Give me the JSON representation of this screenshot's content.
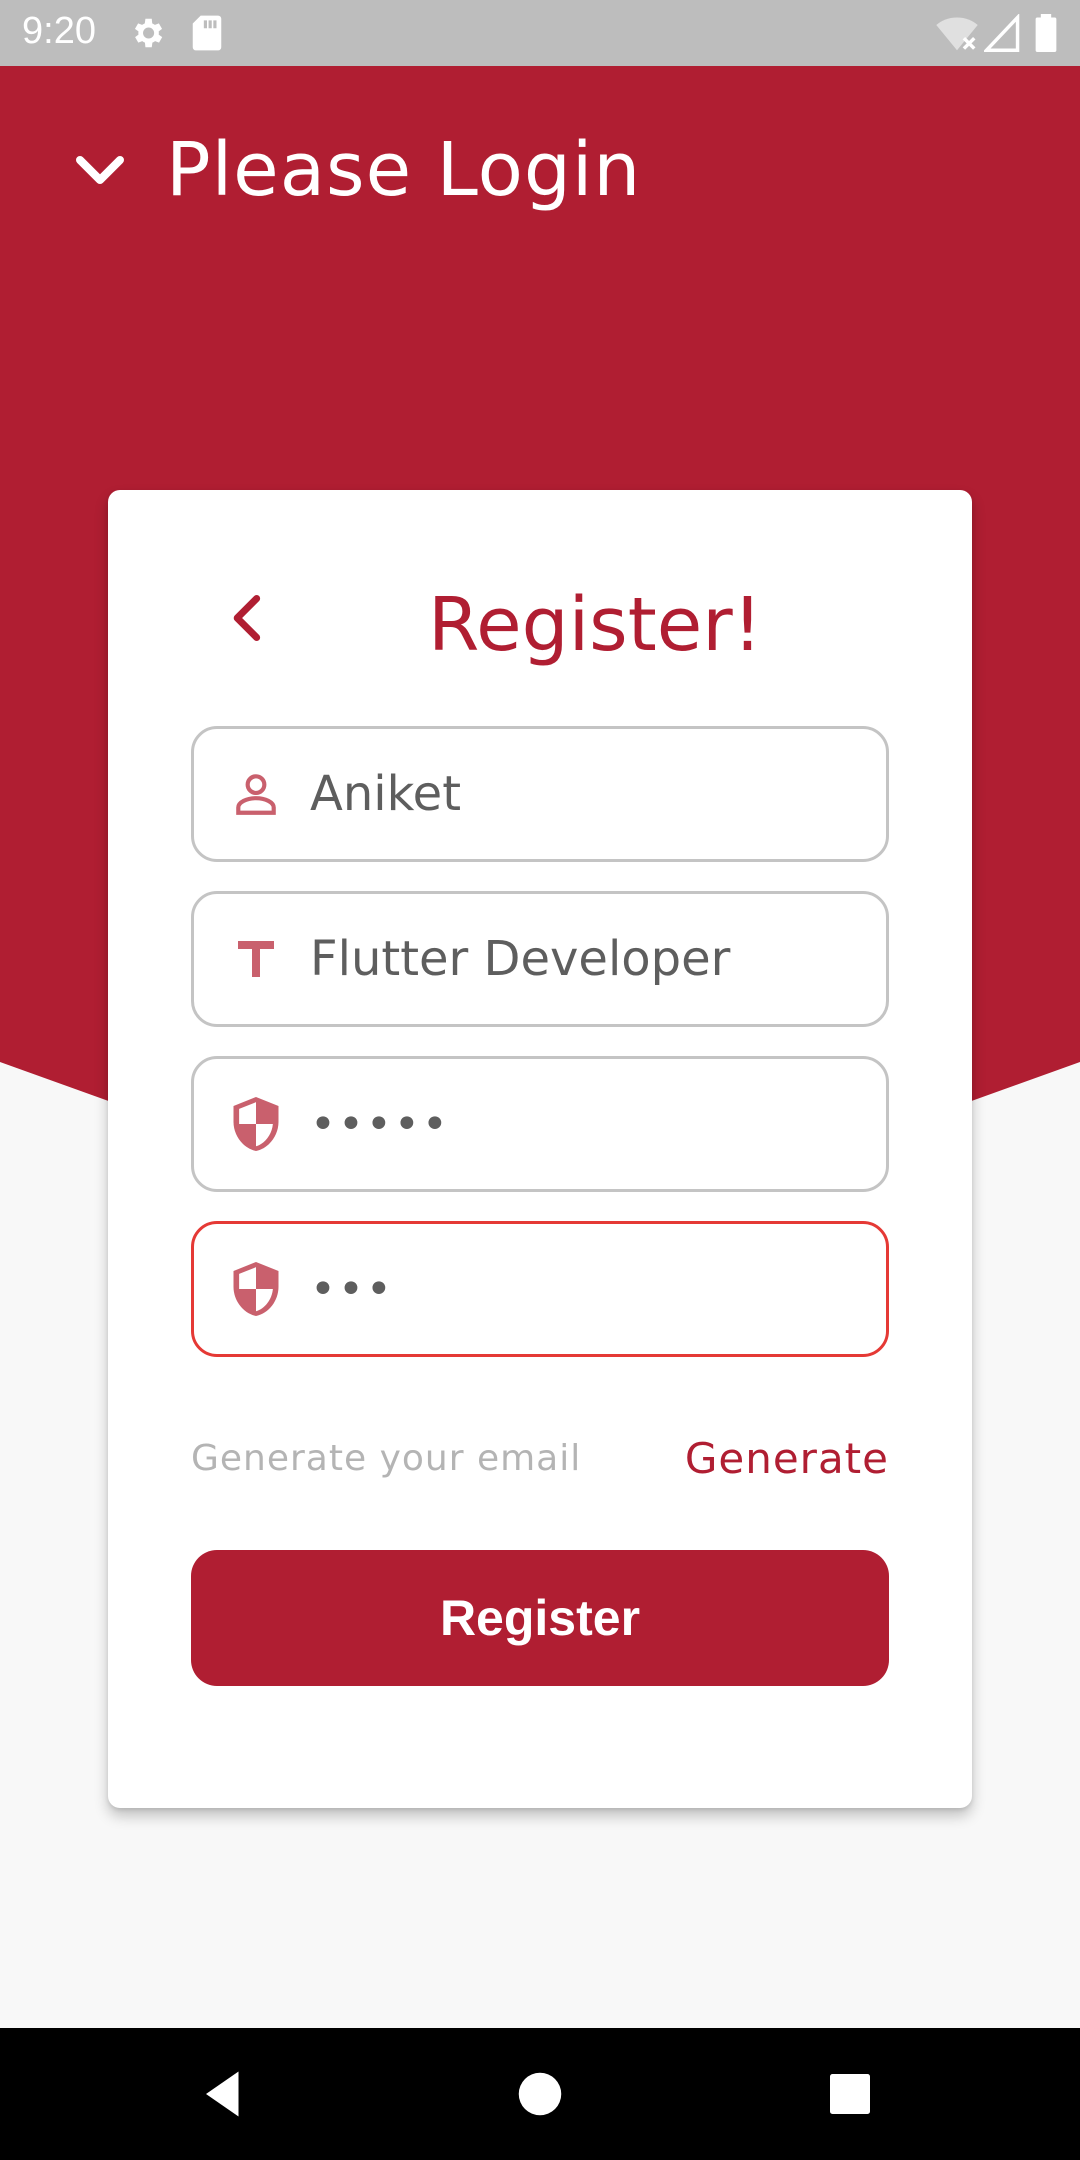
{
  "status_bar": {
    "time": "9:20",
    "icons": [
      "settings-icon",
      "sd-card-icon",
      "wifi-off-icon",
      "signal-icon",
      "battery-icon"
    ]
  },
  "header": {
    "title": "Please Login",
    "icon": "chevron-down-icon"
  },
  "card": {
    "title": "Register!",
    "back_icon": "chevron-left-icon",
    "fields": [
      {
        "icon": "person-icon",
        "value": "Aniket"
      },
      {
        "icon": "text-icon",
        "value": "Flutter Developer"
      },
      {
        "icon": "shield-icon",
        "value": "•••••"
      },
      {
        "icon": "shield-icon",
        "value": "•••",
        "state": "error"
      }
    ],
    "generate_hint": "Generate your email",
    "generate_label": "Generate",
    "register_label": "Register"
  },
  "nav_bar": {
    "icons": [
      "back-icon",
      "home-icon",
      "recents-icon"
    ]
  },
  "colors": {
    "primary": "#b01e32",
    "error": "#e53935",
    "background": "#f8f8f8",
    "card": "#ffffff"
  }
}
